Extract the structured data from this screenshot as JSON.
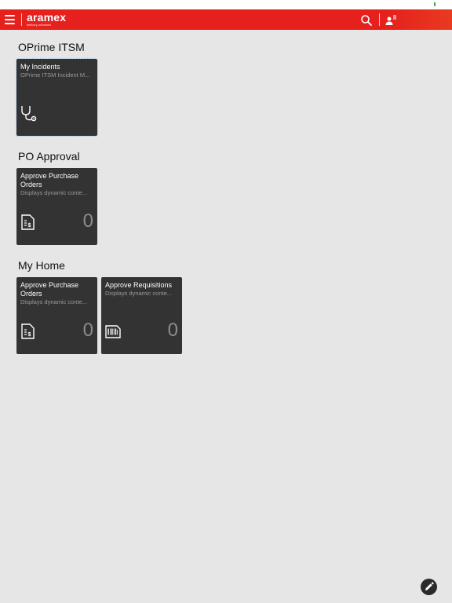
{
  "header": {
    "logo_main": "aramex",
    "logo_sub": "delivery unlimited"
  },
  "sections": [
    {
      "title": "OPrime ITSM",
      "tiles": [
        {
          "title": "My Incidents",
          "subtitle": "OPrime ITSM Incident M...",
          "icon": "stethoscope-icon",
          "count": ""
        }
      ]
    },
    {
      "title": "PO Approval",
      "tiles": [
        {
          "title": "Approve Purchase Orders",
          "subtitle": "Displays dynamic conte...",
          "icon": "invoice-dollar-icon",
          "count": "0"
        }
      ]
    },
    {
      "title": "My Home",
      "tiles": [
        {
          "title": "Approve Purchase Orders",
          "subtitle": "Displays dynamic conte...",
          "icon": "invoice-dollar-icon",
          "count": "0"
        },
        {
          "title": "Approve Requisitions",
          "subtitle": "Displays dynamic conte...",
          "icon": "barcode-document-icon",
          "count": "0"
        }
      ]
    }
  ],
  "colors": {
    "brand_red": "#e5201d",
    "tile_bg": "#333333",
    "page_bg": "#e6e6e6"
  }
}
